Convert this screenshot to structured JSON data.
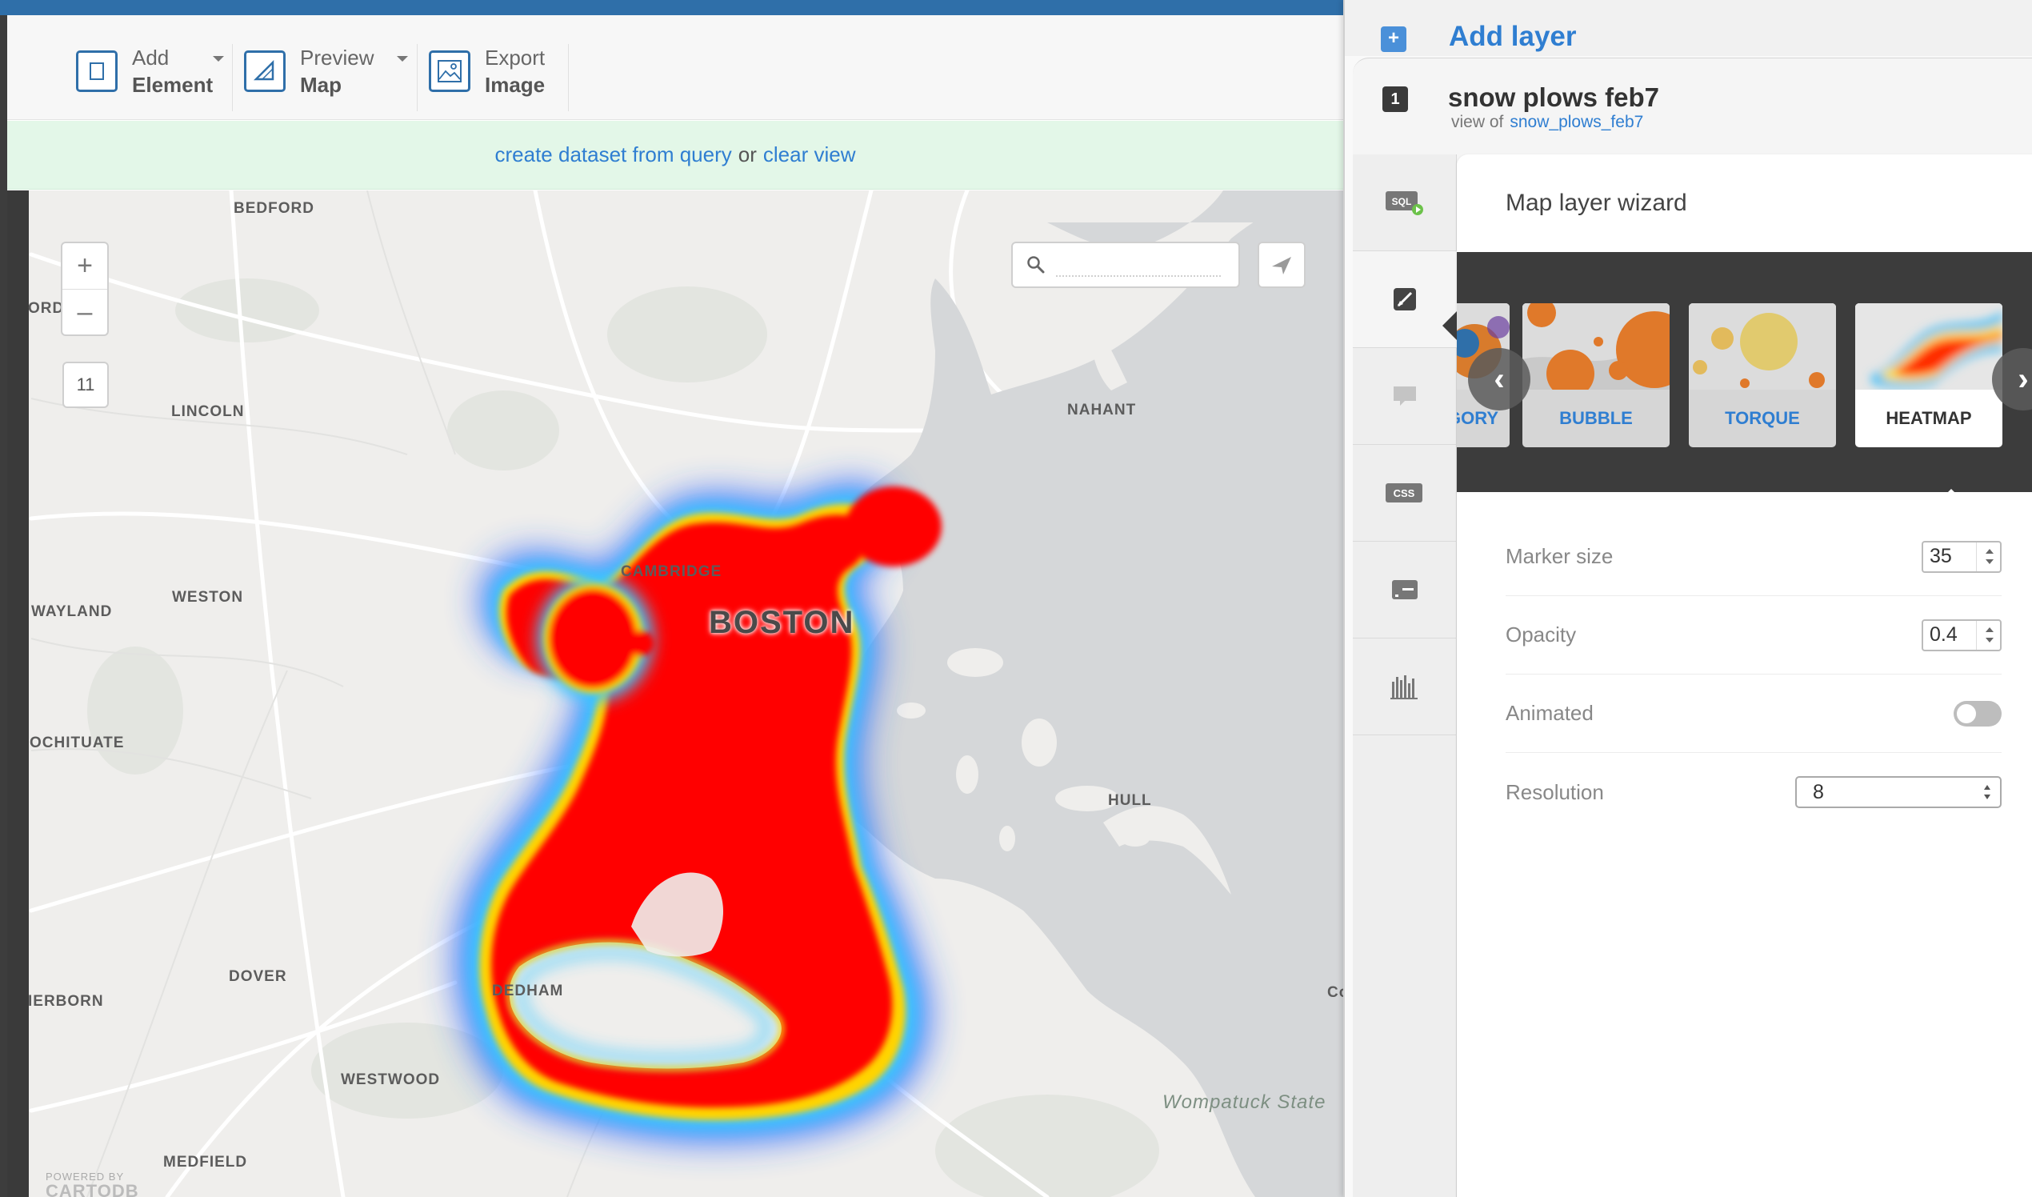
{
  "toolbar": {
    "add_element": {
      "line1": "Add",
      "line2": "Element"
    },
    "preview_map": {
      "line1": "Preview",
      "line2": "Map"
    },
    "export_image": {
      "line1": "Export",
      "line2": "Image"
    }
  },
  "infobar": {
    "create_link": "create dataset from query",
    "or_text": "or",
    "clear_link": "clear view"
  },
  "map": {
    "zoom_in": "+",
    "zoom_out": "–",
    "zoom_level": "11",
    "search_placeholder": "",
    "places": {
      "bedford": "BEDFORD",
      "ford": "ORD",
      "lincoln": "LINCOLN",
      "nahant": "NAHANT",
      "cambridge": "CAMBRIDGE",
      "boston": "BOSTON",
      "wayland": "WAYLAND",
      "weston": "WESTON",
      "scituate": "OCHITUATE",
      "hull": "HULL",
      "dover": "DOVER",
      "dedham": "DEDHAM",
      "sherborn": "IERBORN",
      "westwood": "WESTWOOD",
      "medfield": "MEDFIELD",
      "wompatuck": "Wompatuck State",
      "coast": "Co"
    },
    "powered_by": "POWERED BY",
    "brand": "CARTODB",
    "heat_colors": [
      "#ff0000",
      "#ffff00",
      "#00ff00",
      "#00ffff",
      "#0000ff"
    ]
  },
  "panel": {
    "add_layer": "Add layer",
    "layer_number": "1",
    "layer_name": "snow plows feb7",
    "view_of": "view of",
    "table_link": "snow_plows_feb7",
    "side_tabs": [
      "sql-icon",
      "wizard-icon",
      "infowindow-icon",
      "css-icon",
      "legend-icon",
      "filters-icon"
    ],
    "wizard_title": "Map layer wizard",
    "viz_types": [
      "EGORY",
      "BUBBLE",
      "TORQUE",
      "HEATMAP"
    ],
    "selected_type": "HEATMAP",
    "properties": {
      "marker_size_label": "Marker size",
      "marker_size_value": "35",
      "opacity_label": "Opacity",
      "opacity_value": "0.4",
      "animated_label": "Animated",
      "animated_on": false,
      "resolution_label": "Resolution",
      "resolution_value": "8"
    },
    "accent_color": "#2f7ed1"
  }
}
